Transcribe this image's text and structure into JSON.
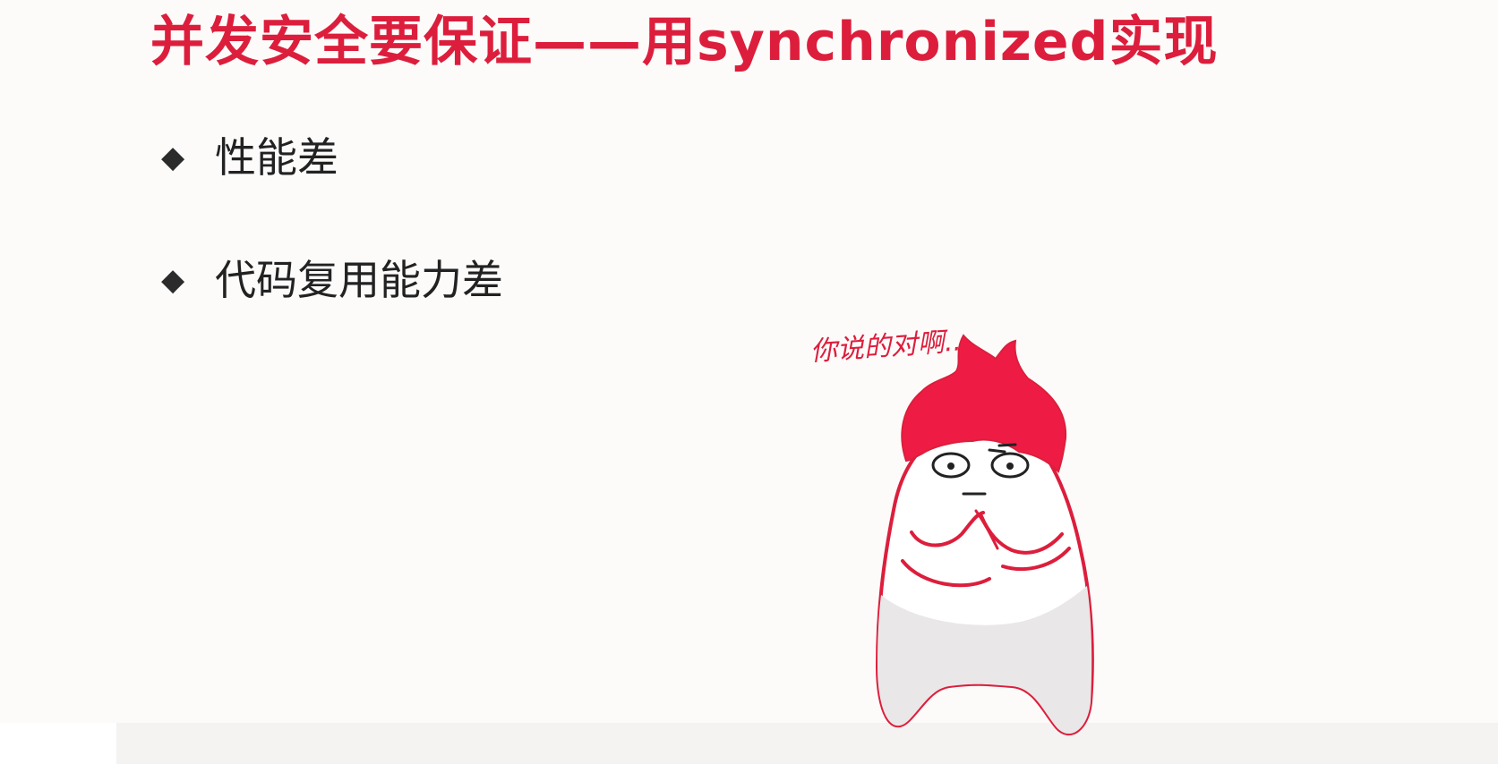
{
  "slide": {
    "title": "并发安全要保证——用synchronized实现",
    "bullets": [
      {
        "marker": "◆",
        "text": "性能差"
      },
      {
        "marker": "◆",
        "text": "代码复用能力差"
      }
    ],
    "speech_bubble": "你说的对啊...",
    "mascot_icon": "red-flame-hair-cartoon-character",
    "colors": {
      "accent": "#dc1e3c",
      "text": "#222222",
      "background": "#fcfbfa"
    }
  }
}
